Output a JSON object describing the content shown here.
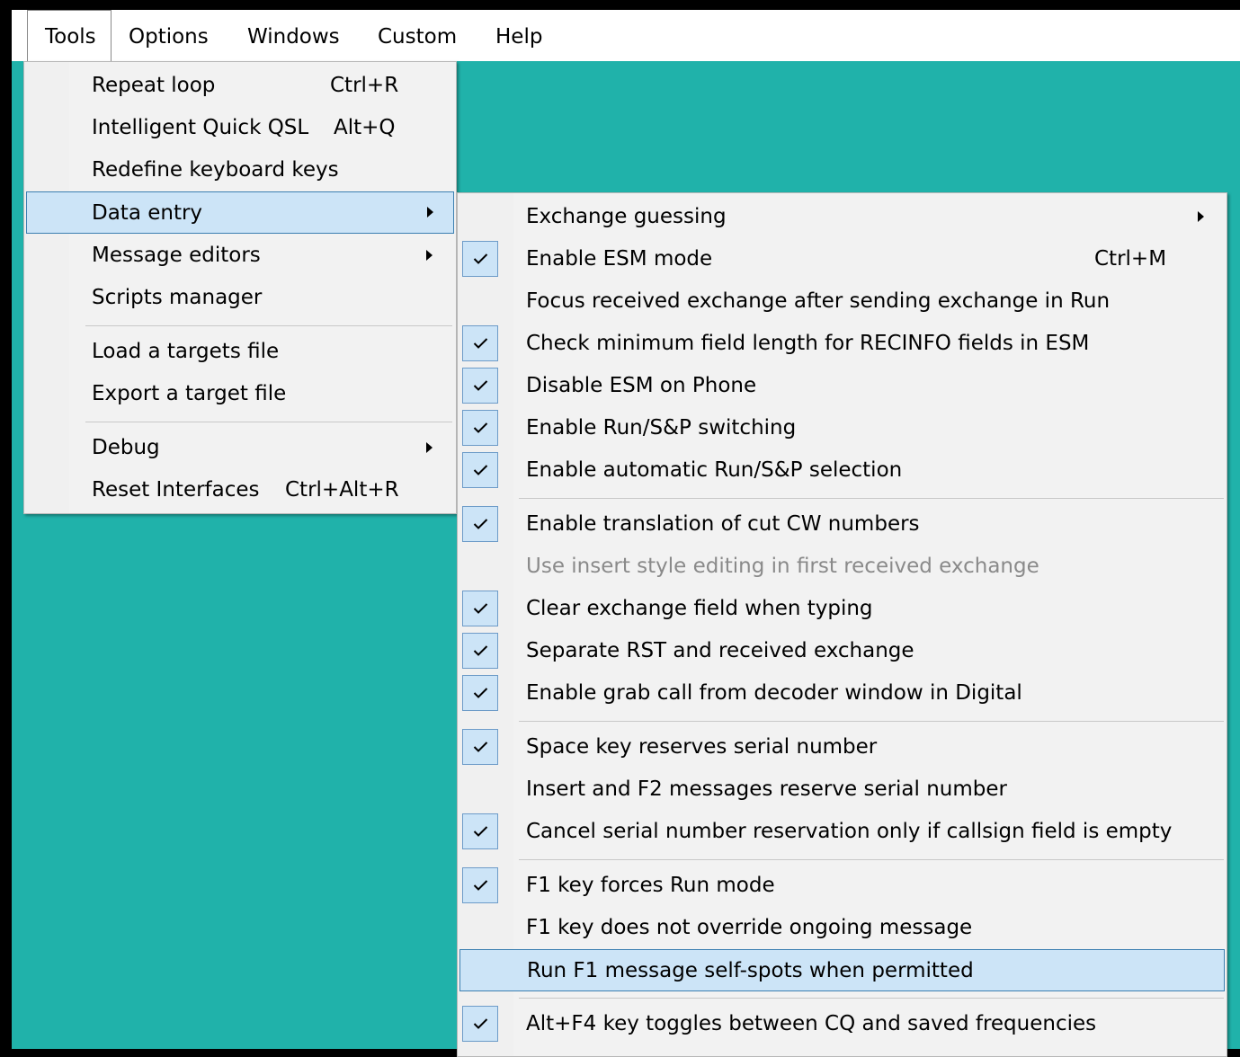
{
  "menubar": {
    "items": [
      "Tools",
      "Options",
      "Windows",
      "Custom",
      "Help"
    ]
  },
  "tools_menu": {
    "items": [
      {
        "label": "Repeat loop",
        "shortcut": "Ctrl+R"
      },
      {
        "label": "Intelligent Quick QSL",
        "shortcut": "Alt+Q"
      },
      {
        "label": "Redefine keyboard keys",
        "shortcut": ""
      },
      {
        "label": "Data entry",
        "shortcut": "",
        "submenu": true
      },
      {
        "label": "Message editors",
        "shortcut": "",
        "submenu": true
      },
      {
        "label": "Scripts manager",
        "shortcut": ""
      },
      {
        "label": "Load a targets file",
        "shortcut": ""
      },
      {
        "label": "Export a target file",
        "shortcut": ""
      },
      {
        "label": "Debug",
        "shortcut": "",
        "submenu": true
      },
      {
        "label": "Reset Interfaces",
        "shortcut": "Ctrl+Alt+R"
      }
    ]
  },
  "data_entry_menu": {
    "items": [
      {
        "label": "Exchange guessing",
        "checked": false,
        "submenu": true
      },
      {
        "label": "Enable ESM mode",
        "checked": true,
        "shortcut": "Ctrl+M"
      },
      {
        "label": "Focus received exchange after sending exchange in Run",
        "checked": false
      },
      {
        "label": "Check minimum field length for RECINFO fields in ESM",
        "checked": true
      },
      {
        "label": "Disable ESM on Phone",
        "checked": true
      },
      {
        "label": "Enable Run/S&P switching",
        "checked": true
      },
      {
        "label": "Enable automatic Run/S&P selection",
        "checked": true
      },
      {
        "label": "Enable translation of cut CW numbers",
        "checked": true
      },
      {
        "label": "Use insert style editing in first received exchange",
        "checked": false,
        "disabled": true
      },
      {
        "label": "Clear exchange field when typing",
        "checked": true
      },
      {
        "label": "Separate RST and received exchange",
        "checked": true
      },
      {
        "label": "Enable grab call from decoder window in Digital",
        "checked": true
      },
      {
        "label": "Space key reserves serial number",
        "checked": true
      },
      {
        "label": "Insert and F2 messages reserve serial number",
        "checked": false
      },
      {
        "label": "Cancel serial number reservation only if callsign field is empty",
        "checked": true
      },
      {
        "label": "F1 key forces Run mode",
        "checked": true
      },
      {
        "label": "F1 key does not override ongoing message",
        "checked": false
      },
      {
        "label": "Run F1 message self-spots when permitted",
        "checked": false,
        "highlighted": true
      },
      {
        "label": "Alt+F4 key toggles between CQ and saved frequencies",
        "checked": true
      }
    ]
  }
}
